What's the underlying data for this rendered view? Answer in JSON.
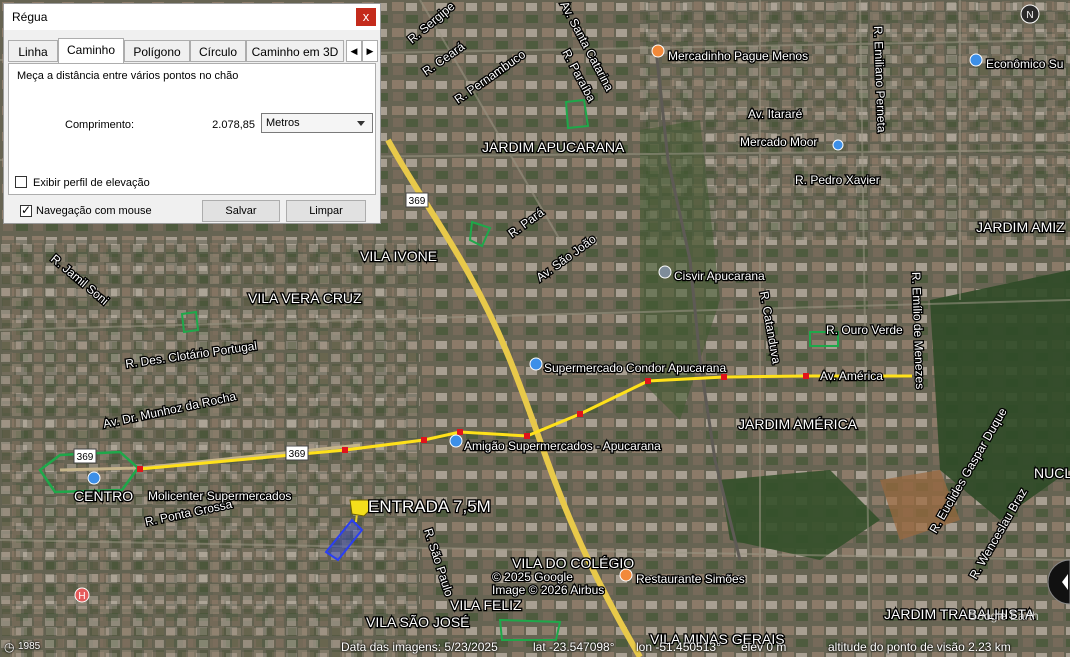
{
  "ruler": {
    "title": "Régua",
    "close_glyph": "x",
    "tabs": [
      "Linha",
      "Caminho",
      "Polígono",
      "Círculo",
      "Caminho em 3D"
    ],
    "active_tab": "Caminho",
    "description": "Meça a distância entre vários pontos no chão",
    "length_label": "Comprimento:",
    "length_value": "2.078,85",
    "units": "Metros",
    "elevation_profile_label": "Exibir perfil de elevação",
    "elevation_profile_checked": false,
    "mouse_nav_label": "Navegação com mouse",
    "mouse_nav_checked": true,
    "save_label": "Salvar",
    "clear_label": "Limpar"
  },
  "map": {
    "streets": [
      "R. Sergipe",
      "R. Ceará",
      "R. Pernambuco",
      "Av. Santa Catarina",
      "R. Paraíba",
      "R. Emiliano Perneta",
      "Av. Itararé",
      "R. Pedro Xavier",
      "R. Pará",
      "Av. São João",
      "R. Jamil Soni",
      "R. Des. Clotário Portugal",
      "Av. Dr. Munhoz da Rocha",
      "R. Ponta Grossa",
      "R. São Paulo",
      "R. Catanduva",
      "R. Ouro Verde",
      "R. Emílio de Menezes",
      "Av. América",
      "R. Euclides Gaspar Duque",
      "R. Wenceslau Braz"
    ],
    "neighborhoods": [
      "JARDIM APUCARANA",
      "VILA IVONE",
      "VILA VERA CRUZ",
      "CENTRO",
      "JARDIM AMÉRICA",
      "JARDIM AMIZ",
      "NUCL",
      "VILA DO COLÉGIO",
      "VILA FELIZ",
      "VILA SÃO JOSÉ",
      "VILA MINAS GERAIS",
      "JARDIM TRABALHISTA"
    ],
    "places": [
      "Mercadinho Pague Menos",
      "Econômico Su",
      "Mercado Moor",
      "Cisvir Apucarana",
      "Supermercado Condor Apucarana",
      "Amigão Supermercados - Apucarana",
      "Molicenter Supermercados",
      "Restaurante Simões"
    ],
    "road_shields": [
      "369",
      "369",
      "369"
    ],
    "placemark_label": "ENTRADA 7,5M",
    "copyright": [
      "© 2025 Google",
      "Image © 2026 Airbus"
    ],
    "watermark": "Google Earth",
    "north_label": "N",
    "colors": {
      "path": "#ffe11a",
      "vertex": "#e0131b",
      "road": "#e8c94a",
      "placemark": "#f4df1b"
    }
  },
  "status": {
    "year": "1985",
    "imagery_date": "Data das imagens: 5/23/2025",
    "lat": "lat -23.547098°",
    "lon": "lon -51.450513°",
    "elev": "elev 0 m",
    "eye_alt": "altitude do ponto de visão 2.23 km"
  }
}
